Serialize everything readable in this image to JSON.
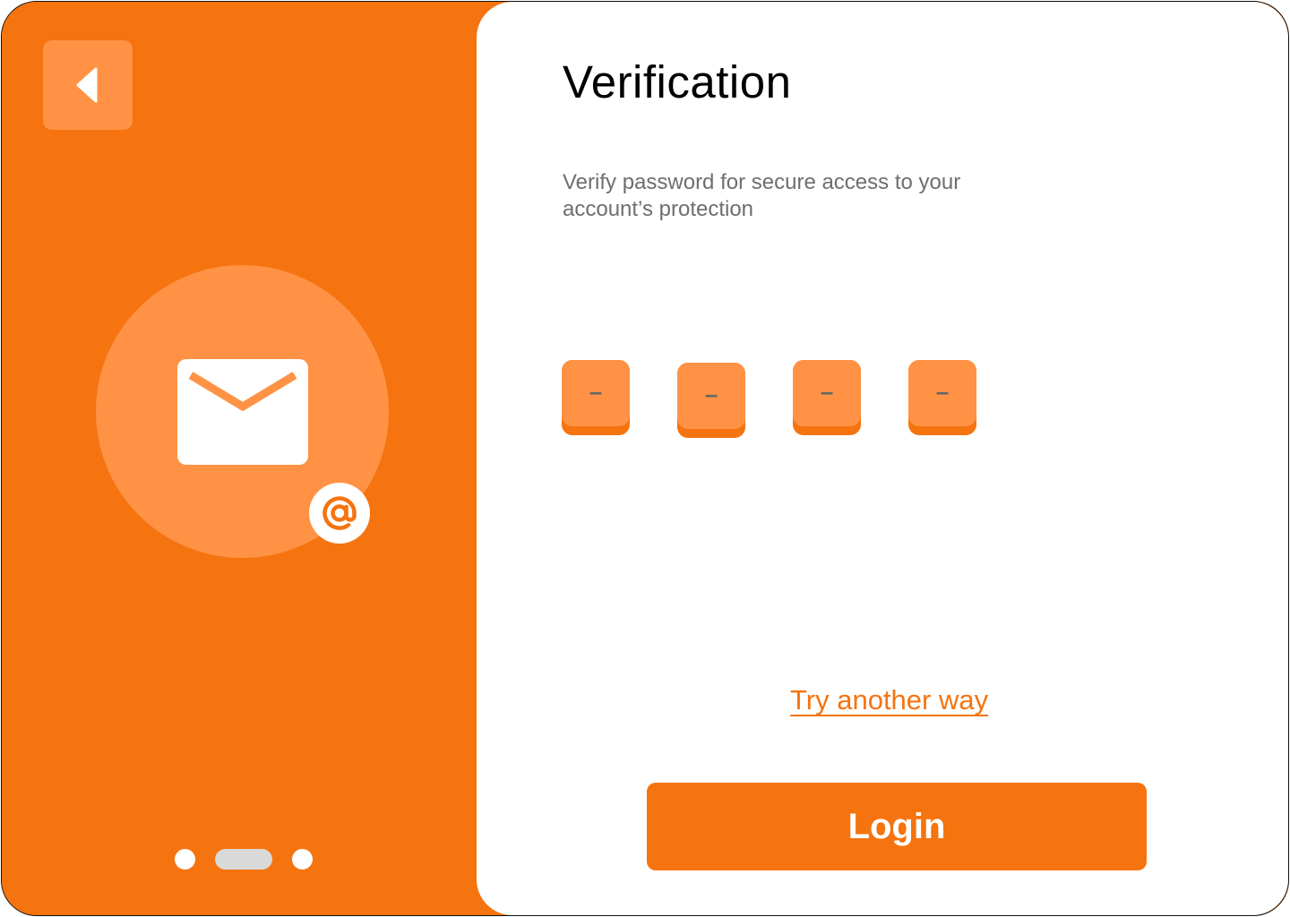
{
  "colors": {
    "accent": "#F57410",
    "accent_light": "#FF9245",
    "background": "#FFFFFF",
    "text_primary": "#000000",
    "text_muted": "#6E6E6E",
    "pager_active": "#D9D9D9"
  },
  "left_panel": {
    "back_icon": "chevron-left-icon",
    "hero_icon": "mail-icon",
    "badge_icon": "at-sign-icon",
    "pager": {
      "count": 3,
      "active_index": 1
    }
  },
  "verification": {
    "title": "Verification",
    "subtitle": "Verify password for secure access to your account’s protection",
    "otp_fields": [
      {
        "value": "–"
      },
      {
        "value": "–"
      },
      {
        "value": "–"
      },
      {
        "value": "–"
      }
    ],
    "try_another_label": "Try another way",
    "login_label": "Login"
  }
}
